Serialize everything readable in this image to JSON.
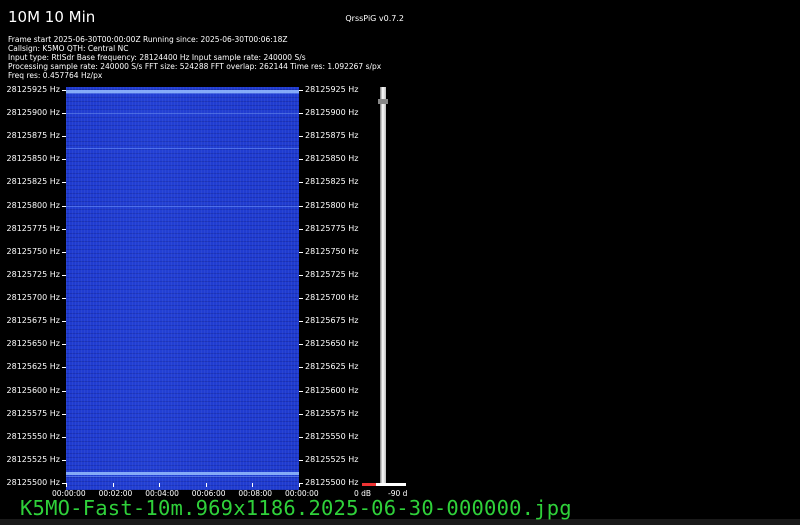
{
  "header": {
    "title": "10M 10 Min",
    "version": "QrssPiG v0.7.2",
    "info_lines": [
      "Frame start 2025-06-30T00:00:00Z Running since: 2025-06-30T00:06:18Z",
      "Callsign: K5MO QTH: Central NC",
      "Input type: RtlSdr Base frequency: 28124400 Hz Input sample rate: 240000 S/s",
      "Processing sample rate: 240000 S/s FFT size: 524288 FFT overlap: 262144 Time res: 1.092267 s/px",
      "Freq res: 0.457764 Hz/px"
    ]
  },
  "y_axis": {
    "labels": [
      "28125925 Hz",
      "28125900 Hz",
      "28125875 Hz",
      "28125850 Hz",
      "28125825 Hz",
      "28125800 Hz",
      "28125775 Hz",
      "28125750 Hz",
      "28125725 Hz",
      "28125700 Hz",
      "28125675 Hz",
      "28125650 Hz",
      "28125625 Hz",
      "28125600 Hz",
      "28125575 Hz",
      "28125550 Hz",
      "28125525 Hz",
      "28125500 Hz"
    ]
  },
  "x_axis": {
    "labels": [
      "00:00:00",
      "00:02:00",
      "00:04:00",
      "00:06:00",
      "00:08:00",
      "00:00:00"
    ]
  },
  "colorbar": {
    "min_label": "0 dB",
    "max_label": "-90 d",
    "marker_fraction": 0.03
  },
  "waterfall": {
    "accent": "#1f3bd0",
    "signal_lines_hz": [
      28125925,
      28125922,
      28125900,
      28125862,
      28125800,
      28125512,
      28125508
    ]
  },
  "footer": {
    "filename": "K5MO-Fast-10m.969x1186.2025-06-30-000000.jpg",
    "color": "#2fd13a"
  }
}
